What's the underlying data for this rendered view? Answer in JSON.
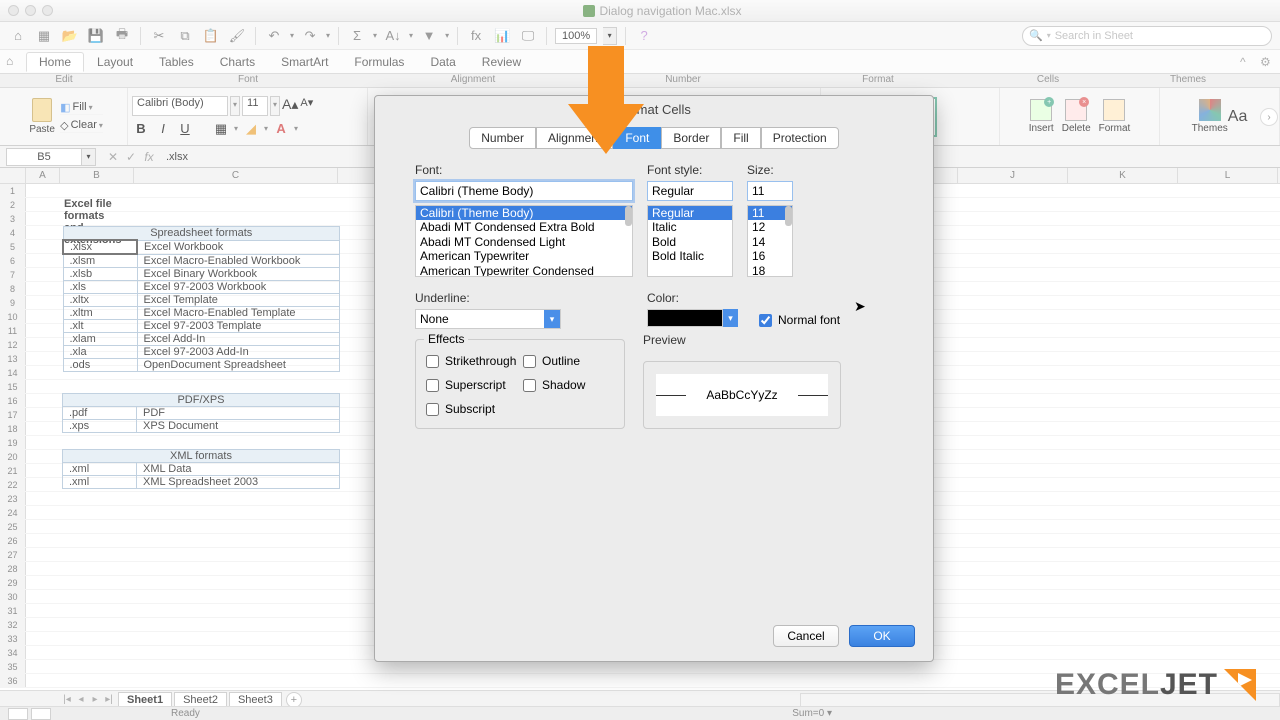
{
  "titlebar": {
    "filename": "Dialog navigation Mac.xlsx"
  },
  "toolbar": {
    "zoom": "100%",
    "search_placeholder": "Search in Sheet"
  },
  "ribbon": {
    "tabs": [
      "Home",
      "Layout",
      "Tables",
      "Charts",
      "SmartArt",
      "Formulas",
      "Data",
      "Review"
    ],
    "active_tab": "Home",
    "groups": {
      "edit": "Edit",
      "font": "Font",
      "alignment": "Alignment",
      "number": "Number",
      "format": "Format",
      "cells": "Cells",
      "themes": "Themes"
    },
    "paste": "Paste",
    "fill": "Fill",
    "clear": "Clear",
    "font_name": "Calibri (Body)",
    "font_size": "11",
    "insert": "Insert",
    "delete": "Delete",
    "format_btn": "Format",
    "themes_btn": "Themes"
  },
  "formula_bar": {
    "name_box": "B5",
    "formula": ".xlsx"
  },
  "columns": [
    "A",
    "B",
    "C",
    "D",
    "J",
    "K",
    "L"
  ],
  "col_widths": {
    "A": 34,
    "B": 74,
    "C": 204,
    "D": 62
  },
  "sheet": {
    "heading": "Excel file formats and extensions",
    "table1_header": "Spreadsheet formats",
    "table1": [
      [
        ".xlsx",
        "Excel Workbook"
      ],
      [
        ".xlsm",
        "Excel Macro-Enabled Workbook"
      ],
      [
        ".xlsb",
        "Excel Binary Workbook"
      ],
      [
        ".xls",
        "Excel 97-2003 Workbook"
      ],
      [
        ".xltx",
        "Excel Template"
      ],
      [
        ".xltm",
        "Excel Macro-Enabled Template"
      ],
      [
        ".xlt",
        "Excel 97-2003 Template"
      ],
      [
        ".xlam",
        "Excel Add-In"
      ],
      [
        ".xla",
        "Excel 97-2003 Add-In"
      ],
      [
        ".ods",
        "OpenDocument Spreadsheet"
      ]
    ],
    "table2_header": "PDF/XPS",
    "table2": [
      [
        ".pdf",
        "PDF"
      ],
      [
        ".xps",
        "XPS Document"
      ]
    ],
    "table3_header": "XML formats",
    "table3": [
      [
        ".xml",
        "XML Data"
      ],
      [
        ".xml",
        "XML Spreadsheet 2003"
      ]
    ]
  },
  "tabs": {
    "sheets": [
      "Sheet1",
      "Sheet2",
      "Sheet3"
    ],
    "active": 0,
    "add": "+"
  },
  "status": {
    "ready": "Ready",
    "sum": "Sum=0"
  },
  "dialog": {
    "title": "Format Cells",
    "tabs": [
      "Number",
      "Alignment",
      "Font",
      "Border",
      "Fill",
      "Protection"
    ],
    "active_tab": "Font",
    "font_label": "Font:",
    "font_value": "Calibri (Theme Body)",
    "font_list": [
      "Calibri (Theme Body)",
      "Abadi MT Condensed Extra Bold",
      "Abadi MT Condensed Light",
      "American Typewriter",
      "American Typewriter Condensed"
    ],
    "style_label": "Font style:",
    "style_value": "Regular",
    "style_list": [
      "Regular",
      "Italic",
      "Bold",
      "Bold Italic"
    ],
    "size_label": "Size:",
    "size_value": "11",
    "size_list": [
      "11",
      "12",
      "14",
      "16",
      "18"
    ],
    "underline_label": "Underline:",
    "underline_value": "None",
    "color_label": "Color:",
    "normal_font": "Normal font",
    "effects_label": "Effects",
    "effects": {
      "strike": "Strikethrough",
      "outline": "Outline",
      "superscript": "Superscript",
      "shadow": "Shadow",
      "subscript": "Subscript"
    },
    "preview_label": "Preview",
    "preview_text": "AaBbCcYyZz",
    "cancel": "Cancel",
    "ok": "OK"
  },
  "logo": {
    "part1": "EXCEL",
    "part2": "JET"
  }
}
